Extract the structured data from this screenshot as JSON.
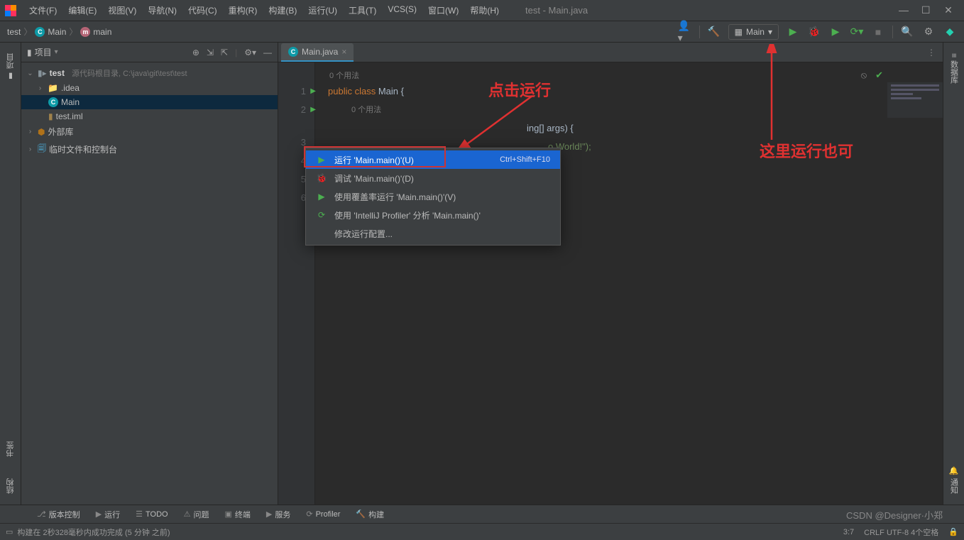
{
  "title": "test - Main.java",
  "menu": {
    "file": "文件(F)",
    "edit": "编辑(E)",
    "view": "视图(V)",
    "navigate": "导航(N)",
    "code": "代码(C)",
    "refactor": "重构(R)",
    "build": "构建(B)",
    "run": "运行(U)",
    "tools": "工具(T)",
    "vcs": "VCS(S)",
    "window": "窗口(W)",
    "help": "帮助(H)"
  },
  "breadcrumb": {
    "project": "test",
    "class": "Main",
    "method": "main"
  },
  "runConfig": {
    "label": "Main"
  },
  "projectPanel": {
    "title": "项目",
    "rootName": "test",
    "rootMeta": "源代码根目录,  C:\\java\\git\\test\\test",
    "idea": ".idea",
    "mainClass": "Main",
    "iml": "test.iml",
    "extLib": "外部库",
    "scratches": "临时文件和控制台"
  },
  "tab": {
    "name": "Main.java"
  },
  "hints": {
    "usage0a": "0 个用法",
    "usage0b": "0 个用法"
  },
  "code": {
    "l1_kw1": "public",
    "l1_kw2": "class",
    "l1_cls": "Main",
    "l1_brace": "{",
    "l2_part1": "ing[] args) {",
    "l3_part1": "o World!\");",
    "lineNums": [
      "1",
      "2",
      "3",
      "4",
      "5",
      "6"
    ]
  },
  "contextMenu": {
    "run": "运行 'Main.main()'(U)",
    "runShortcut": "Ctrl+Shift+F10",
    "debug": "调试 'Main.main()'(D)",
    "coverage": "使用覆盖率运行  'Main.main()'(V)",
    "profiler": "使用 'IntelliJ Profiler' 分析  'Main.main()'",
    "modify": "修改运行配置..."
  },
  "annotations": {
    "clickRun": "点击运行",
    "runHere": "这里运行也可"
  },
  "leftGutter": {
    "project": "项目",
    "bookmarks": "书签",
    "structure": "结构"
  },
  "rightGutter": {
    "database": "数据库",
    "notifications": "通知"
  },
  "bottomBar": {
    "vcs": "版本控制",
    "run": "运行",
    "todo": "TODO",
    "problems": "问题",
    "terminal": "终端",
    "services": "服务",
    "profiler": "Profiler",
    "build": "构建"
  },
  "statusBar": {
    "message": "构建在 2秒328毫秒内成功完成 (5 分钟 之前)",
    "lineCol": "3:7",
    "encoding": "CRLF   UTF-8   4个空格"
  },
  "watermark": "CSDN @Designer·小郑"
}
